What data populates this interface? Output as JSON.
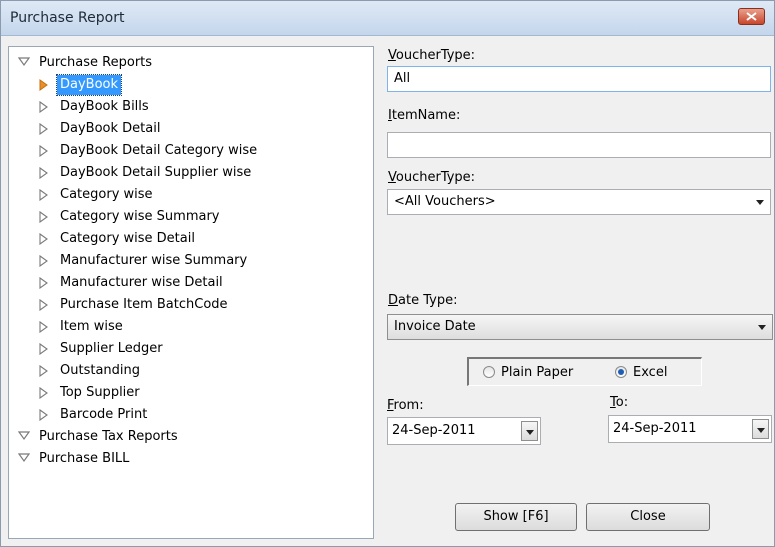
{
  "window": {
    "title": "Purchase Report"
  },
  "tree": {
    "groups": [
      {
        "label": "Purchase Reports",
        "expanded": true
      },
      {
        "label": "Purchase Tax Reports",
        "expanded": true
      },
      {
        "label": "Purchase BILL",
        "expanded": true
      }
    ],
    "items": [
      "DayBook",
      "DayBook Bills",
      "DayBook Detail",
      "DayBook Detail Category wise",
      "DayBook Detail Supplier wise",
      "Category wise",
      "Category wise Summary",
      "Category wise Detail",
      "Manufacturer wise Summary",
      "Manufacturer wise Detail",
      "Purchase Item BatchCode",
      "Item wise",
      "Supplier Ledger",
      "Outstanding",
      "Top Supplier",
      "Barcode Print"
    ],
    "selected": "DayBook"
  },
  "form": {
    "voucher_type_label_accel": "V",
    "voucher_type_label_rest": "oucherType:",
    "voucher_type_value": "All",
    "item_name_label_accel": "I",
    "item_name_label_rest": "temName:",
    "item_name_value": "",
    "voucher_type2_label_accel": "V",
    "voucher_type2_label_rest": "oucherType:",
    "voucher_type2_value": "<All Vouchers>",
    "date_type_label_accel": "D",
    "date_type_label_rest": "ate Type:",
    "date_type_value": "Invoice Date",
    "output_options": [
      {
        "label": "Plain Paper",
        "checked": false
      },
      {
        "label": "Excel",
        "checked": true
      }
    ],
    "from_label_accel": "F",
    "from_label_rest": "rom:",
    "from_value": "24-Sep-2011",
    "to_label_accel": "T",
    "to_label_rest": "o:",
    "to_value": "24-Sep-2011"
  },
  "buttons": {
    "show": "Show [F6]",
    "close": "Close"
  },
  "colors": {
    "selection": "#3399ff",
    "selected_arrow": "#e8912a",
    "title_gradient_top": "#dfe9f5"
  }
}
